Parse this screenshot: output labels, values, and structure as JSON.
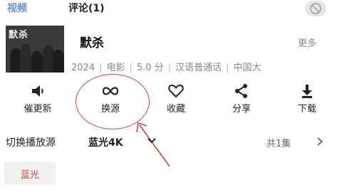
{
  "tabs": {
    "video": "视频",
    "comments": "评论(1)"
  },
  "movie": {
    "title": "默杀",
    "poster_title": "默杀",
    "more": "更多",
    "year": "2024",
    "category": "电影",
    "score": "5.0 分",
    "language": "汉语普通话",
    "region": "中国大"
  },
  "actions": [
    {
      "label": "催更新",
      "icon": "speaker-icon"
    },
    {
      "label": "换源",
      "icon": "infinity-icon"
    },
    {
      "label": "收藏",
      "icon": "heart-icon"
    },
    {
      "label": "分享",
      "icon": "share-icon"
    },
    {
      "label": "下载",
      "icon": "download-icon"
    }
  ],
  "source": {
    "label": "切换播放源",
    "value": "蓝光4K",
    "episodes": "共1集"
  },
  "chip": {
    "label": "蓝光"
  },
  "colors": {
    "accent": "#6a8fd6",
    "highlight": "#c94545",
    "chip_text": "#d34a3a"
  }
}
